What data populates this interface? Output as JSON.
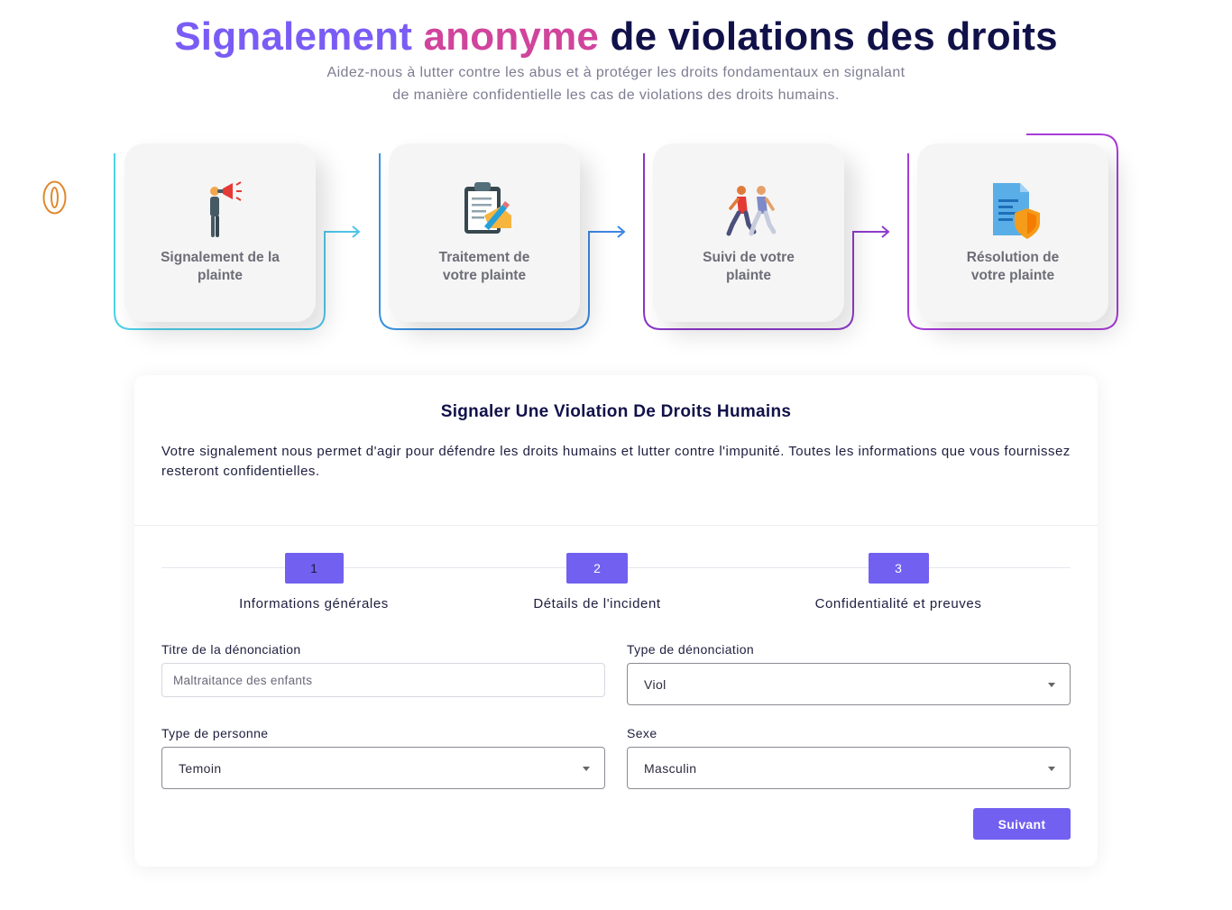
{
  "hero": {
    "title_part1": "Signalement",
    "title_part2": "anonyme",
    "title_part3": "de violations des droits",
    "subtitle_line1": "Aidez-nous à lutter contre les abus et à protéger les droits fondamentaux en signalant",
    "subtitle_line2": "de manière confidentielle les cas de violations des droits humains."
  },
  "process_steps": [
    {
      "label_line1": "Signalement de la",
      "label_line2": "plainte",
      "icon": "megaphone-person-icon"
    },
    {
      "label_line1": "Traitement de",
      "label_line2": "votre plainte",
      "icon": "clipboard-icon"
    },
    {
      "label_line1": "Suivi de votre",
      "label_line2": "plainte",
      "icon": "walking-people-icon"
    },
    {
      "label_line1": "Résolution de",
      "label_line2": "votre plainte",
      "icon": "document-shield-icon"
    }
  ],
  "colors": {
    "accent": "#7260f0",
    "title_gradient_start": "#7a5cf5",
    "title_gradient_end": "#d0449c",
    "title_dark": "#11114a",
    "flow_cyan": "#4fd1e8",
    "flow_blue": "#3a92e0",
    "flow_purple": "#8a36c8",
    "badge_orange": "#e0892e"
  },
  "form": {
    "title": "Signaler Une Violation De Droits Humains",
    "intro": "Votre signalement nous permet d'agir pour défendre les droits humains et lutter contre l'impunité. Toutes les informations que vous fournissez resteront confidentielles.",
    "wizard_steps": [
      {
        "number": "1",
        "name": "Informations générales"
      },
      {
        "number": "2",
        "name": "Détails de l'incident"
      },
      {
        "number": "3",
        "name": "Confidentialité et preuves"
      }
    ],
    "current_step": 1,
    "fields": {
      "titre": {
        "label": "Titre de la dénonciation",
        "placeholder": "Maltraitance des enfants",
        "value": ""
      },
      "type_denonciation": {
        "label": "Type de dénonciation",
        "value": "Viol"
      },
      "type_personne": {
        "label": "Type de personne",
        "value": "Temoin"
      },
      "sexe": {
        "label": "Sexe",
        "value": "Masculin"
      }
    },
    "next_button": "Suivant"
  }
}
